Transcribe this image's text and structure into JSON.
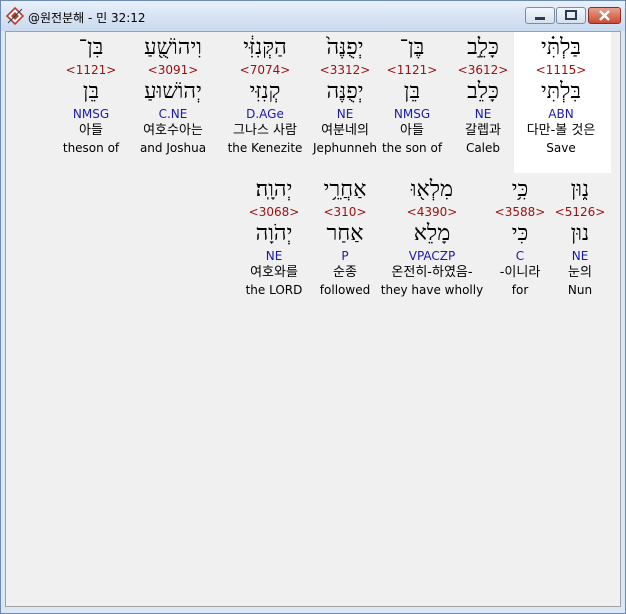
{
  "window": {
    "title": "@원전분해 - 민 32:12"
  },
  "rows": [
    {
      "words": [
        {
          "heb1": "בַּלְתִּ֗י",
          "num": "<1115>",
          "heb2": "בִּלְתִּי",
          "code": "ABN",
          "kor": "다만-볼 것은",
          "eng": "Save",
          "selected": true
        },
        {
          "heb1": "כָּלֵ֣ב",
          "num": "<3612>",
          "heb2": "כָּלֵב",
          "code": "NE",
          "kor": "갈렙과",
          "eng": "Caleb"
        },
        {
          "heb1": "בֶּן־",
          "num": "<1121>",
          "heb2": "בֵּן",
          "code": "NMSG",
          "kor": "아들",
          "eng": "the son of"
        },
        {
          "heb1": "יְפֻנֶּה֙",
          "num": "<3312>",
          "heb2": "יְפֻנֶּה",
          "code": "NE",
          "kor": "여분네의",
          "eng": "Jephunneh"
        },
        {
          "heb1": "הַקְּנִזִּ֔י",
          "num": "<7074>",
          "heb2": "קְנִזִּי",
          "code": "D.AGe",
          "kor": "그나스 사람",
          "eng": "the Kenezite"
        },
        {
          "heb1": "וִיהוֹשֻׁ֖עַ",
          "num": "<3091>",
          "heb2": "יְהוֹשׁוּעַ",
          "code": "C.NE",
          "kor": "여호수아는",
          "eng": "and Joshua"
        },
        {
          "heb1": "בִּן־",
          "num": "<1121>",
          "heb2": "בֵּן",
          "code": "NMSG",
          "kor": "아들",
          "eng": "theson of"
        }
      ]
    },
    {
      "words": [
        {
          "heb1": "נ֑וּן",
          "num": "<5126>",
          "heb2": "נוּן",
          "code": "NE",
          "kor": "눈의",
          "eng": "Nun"
        },
        {
          "heb1": "כִּ֥י",
          "num": "<3588>",
          "heb2": "כִּי",
          "code": "C",
          "kor": "-이니라",
          "eng": "for"
        },
        {
          "heb1": "מִלְא֖וּ",
          "num": "<4390>",
          "heb2": "מָלֵא",
          "code": "VPACZP",
          "kor": "온전히-하였음-",
          "eng": "they have wholly"
        },
        {
          "heb1": "אַחֲרֵ֥י",
          "num": "<310>",
          "heb2": "אַחַר",
          "code": "P",
          "kor": "순종",
          "eng": "followed"
        },
        {
          "heb1": "יְהוָֽה׃",
          "num": "<3068>",
          "heb2": "יְהֹוָה",
          "code": "NE",
          "kor": "여호와를",
          "eng": "the LORD"
        }
      ]
    }
  ]
}
